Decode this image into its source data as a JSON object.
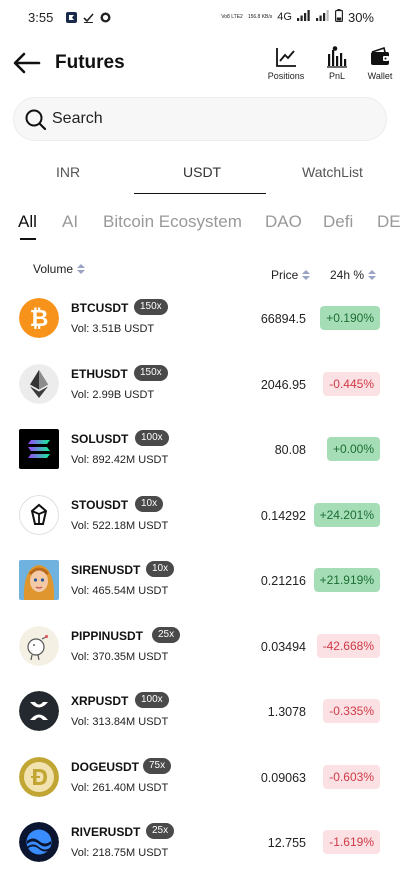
{
  "status_bar": {
    "time": "3:55",
    "network_a": "Vo8 LTE2",
    "network_speed": "156.8 KB/s",
    "network_b": "4G",
    "battery": "30%"
  },
  "header": {
    "title": "Futures",
    "actions": [
      {
        "label": "Positions",
        "icon": "line-chart-icon"
      },
      {
        "label": "PnL",
        "icon": "bar-chart-icon"
      },
      {
        "label": "Wallet",
        "icon": "wallet-icon"
      }
    ]
  },
  "search": {
    "placeholder": "Search"
  },
  "market_tabs": {
    "items": [
      "INR",
      "USDT",
      "WatchList"
    ],
    "active": "USDT"
  },
  "categories": {
    "items": [
      "All",
      "AI",
      "Bitcoin Ecosystem",
      "DAO",
      "Defi",
      "DE"
    ],
    "active": "All"
  },
  "columns": {
    "volume": "Volume",
    "price": "Price",
    "change": "24h %"
  },
  "colors": {
    "up_bg": "#a5deb6",
    "up_text": "#1d6e34",
    "down_bg": "#fbe1e3",
    "down_text": "#d03a48",
    "leverage_badge": "#4a4a4a"
  },
  "rows": [
    {
      "symbol": "BTCUSDT",
      "leverage": "150x",
      "volume": "Vol: 3.51B USDT",
      "price": "66894.5",
      "change": "+0.190%",
      "direction": "up",
      "icon": "bitcoin-icon"
    },
    {
      "symbol": "ETHUSDT",
      "leverage": "150x",
      "volume": "Vol: 2.99B USDT",
      "price": "2046.95",
      "change": "-0.445%",
      "direction": "down",
      "icon": "ethereum-icon"
    },
    {
      "symbol": "SOLUSDT",
      "leverage": "100x",
      "volume": "Vol: 892.42M USDT",
      "price": "80.08",
      "change": "+0.00%",
      "direction": "up",
      "icon": "solana-icon"
    },
    {
      "symbol": "STOUSDT",
      "leverage": "10x",
      "volume": "Vol: 522.18M USDT",
      "price": "0.14292",
      "change": "+24.201%",
      "direction": "up",
      "icon": "sto-icon"
    },
    {
      "symbol": "SIRENUSDT",
      "leverage": "10x",
      "volume": "Vol: 465.54M USDT",
      "price": "0.21216",
      "change": "+21.919%",
      "direction": "up",
      "icon": "siren-icon"
    },
    {
      "symbol": "PIPPINUSDT",
      "leverage": "25x",
      "volume": "Vol: 370.35M USDT",
      "price": "0.03494",
      "change": "-42.668%",
      "direction": "down",
      "icon": "pippin-icon"
    },
    {
      "symbol": "XRPUSDT",
      "leverage": "100x",
      "volume": "Vol: 313.84M USDT",
      "price": "1.3078",
      "change": "-0.335%",
      "direction": "down",
      "icon": "xrp-icon"
    },
    {
      "symbol": "DOGEUSDT",
      "leverage": "75x",
      "volume": "Vol: 261.40M USDT",
      "price": "0.09063",
      "change": "-0.603%",
      "direction": "down",
      "icon": "doge-icon"
    },
    {
      "symbol": "RIVERUSDT",
      "leverage": "25x",
      "volume": "Vol: 218.75M USDT",
      "price": "12.755",
      "change": "-1.619%",
      "direction": "down",
      "icon": "river-icon"
    }
  ]
}
